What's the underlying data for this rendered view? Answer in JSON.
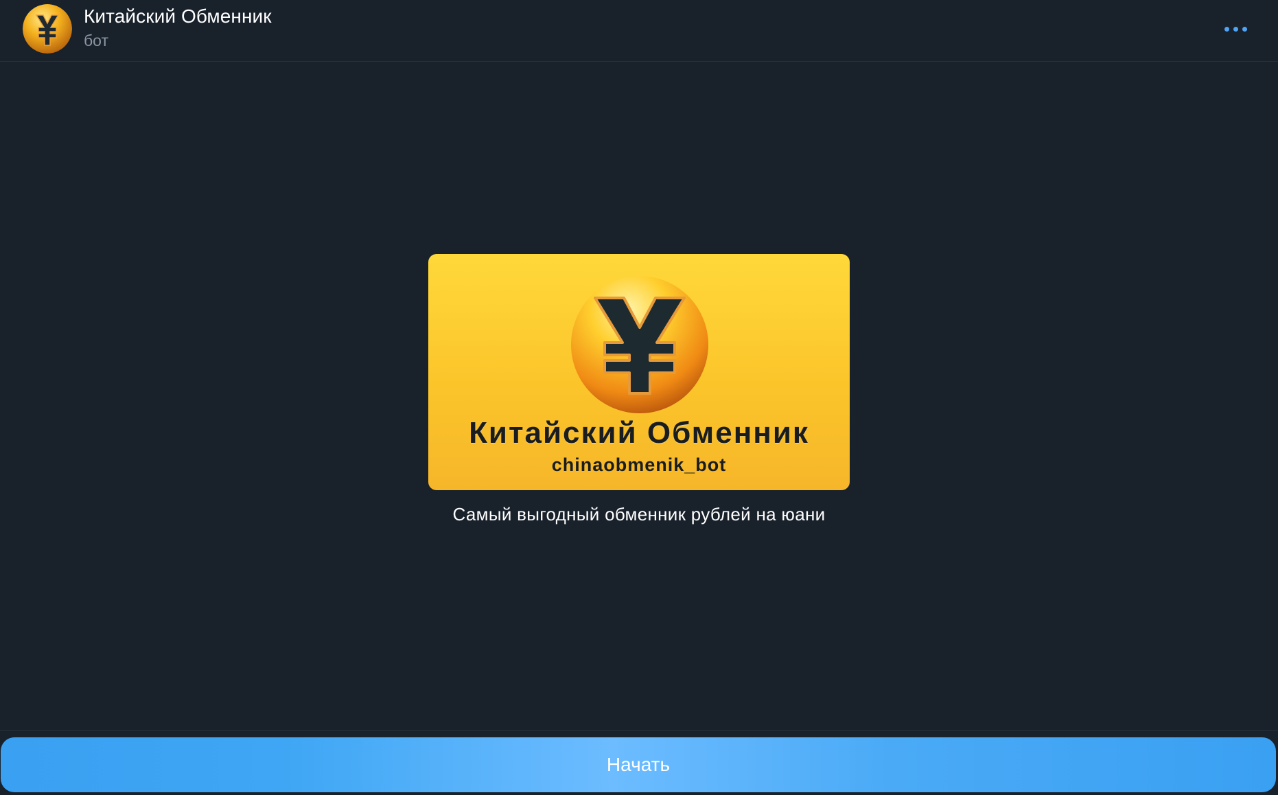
{
  "header": {
    "title": "Китайский Обменник",
    "subtitle": "бот",
    "avatar_icon": "yuan-coin-icon",
    "more_icon": "more-dots-icon"
  },
  "intro": {
    "image_title": "Китайский Обменник",
    "image_subtitle": "chinaobmenik_bot",
    "image_icon": "yuan-coin-icon",
    "description": "Самый выгодный обменник рублей на юани"
  },
  "actions": {
    "start_label": "Начать"
  },
  "colors": {
    "background": "#19212b",
    "accent": "#3ea6f4",
    "brand_yellow": "#fbc52a"
  }
}
